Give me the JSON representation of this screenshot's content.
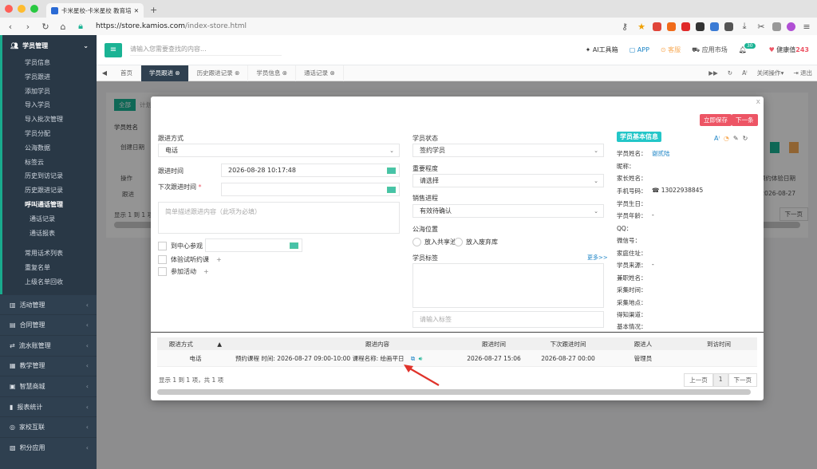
{
  "browser": {
    "tab_title": "卡米星校-卡米星校 教育培训L",
    "url_domain": "https://store.kamios.com",
    "url_path": "/index-store.html"
  },
  "sidebar": {
    "head": "学员管理",
    "sub_items": [
      "学员信息",
      "学员跟进",
      "添加学员",
      "导入学员",
      "导入批次管理",
      "学员分配",
      "公海数据",
      "标签云",
      "历史到访记录",
      "历史跟进记录"
    ],
    "sub_group": "呼叫通话管理",
    "sub_group_items": [
      "通话记录",
      "通话报表"
    ],
    "sub_items2": [
      "常用话术列表",
      "重复名单",
      "上级名单回收"
    ],
    "items": [
      "活动管理",
      "合同管理",
      "流水账管理",
      "教学管理",
      "智慧商城",
      "报表统计",
      "家校互联",
      "积分应用"
    ]
  },
  "topbar": {
    "search_placeholder": "请输入您需要查找的内容...",
    "ai": "AI工具箱",
    "app": "APP",
    "kf": "客服",
    "market": "应用市场",
    "badge": "30",
    "health_label": "健康值",
    "health_value": "243"
  },
  "pagetabs": {
    "tabs": [
      "首页",
      "学员跟进",
      "历史跟进记录",
      "学员信息",
      "通话记录"
    ],
    "close_ops": "关闭操作",
    "logout": "退出"
  },
  "bg": {
    "all": "全部",
    "plan": "计划",
    "name": "学员姓名",
    "created": "创建日期",
    "op": "操作",
    "follow": "跟进",
    "showing": "显示 1 到 1 项",
    "trial_date": "预约体验日期",
    "date": "2026-08-27",
    "next": "下一页"
  },
  "modal": {
    "btn_save": "立即保存",
    "btn_next": "下一条",
    "follow_way_label": "跟进方式",
    "follow_way_value": "电话",
    "follow_time_label": "跟进时间",
    "follow_time_value": "2026-08-28 10:17:48",
    "next_time_label": "下次跟进时间",
    "req": "*",
    "content_placeholder": "简单描述跟进内容（此项为必填）",
    "visit_label": "到中心参观",
    "trial_label": "体验试听约课",
    "activity_label": "参加活动",
    "status_label": "学员状态",
    "status_value": "签约学员",
    "importance_label": "重要程度",
    "importance_value": "请选择",
    "sales_label": "销售进程",
    "sales_value": "有效待确认",
    "pool_label": "公海位置",
    "pool_opt1": "放入共享池",
    "pool_opt2": "放入废弃库",
    "tag_label": "学员标签",
    "more": "更多>>",
    "tag_placeholder": "请输入标签"
  },
  "info": {
    "title": "学员基本信息",
    "rows": [
      {
        "k": "学员姓名：",
        "v": "谢贰陆"
      },
      {
        "k": "昵称：",
        "v": ""
      },
      {
        "k": "家长姓名：",
        "v": ""
      },
      {
        "k": "手机号码：",
        "v": "13022938845"
      },
      {
        "k": "学员生日：",
        "v": ""
      },
      {
        "k": "学员年龄：",
        "v": "-"
      },
      {
        "k": "QQ：",
        "v": ""
      },
      {
        "k": "微信号：",
        "v": ""
      },
      {
        "k": "家庭住址：",
        "v": ""
      },
      {
        "k": "学员来源：",
        "v": "-"
      },
      {
        "k": "兼职姓名：",
        "v": ""
      },
      {
        "k": "采集时间：",
        "v": ""
      },
      {
        "k": "采集地点：",
        "v": ""
      },
      {
        "k": "得知渠道：",
        "v": ""
      },
      {
        "k": "基本情况：",
        "v": ""
      }
    ]
  },
  "table": {
    "headers": [
      "跟进方式",
      "跟进内容",
      "跟进时间",
      "下次跟进时间",
      "跟进人",
      "到访时间"
    ],
    "row": {
      "way": "电话",
      "content": "预约课程 时间: 2026-08-27 09:00-10:00 课程名称: 绘画平日",
      "time": "2026-08-27 15:06",
      "next": "2026-08-27 00:00",
      "person": "管理员",
      "visit": ""
    },
    "pager_text": "显示 1 到 1 项，共 1 项",
    "prev": "上一页",
    "page": "1",
    "next": "下一页"
  },
  "colors": {
    "accent": "#1ab394",
    "danger": "#ed5565",
    "sidebar": "#2f4050",
    "info": "#23c6c8"
  }
}
